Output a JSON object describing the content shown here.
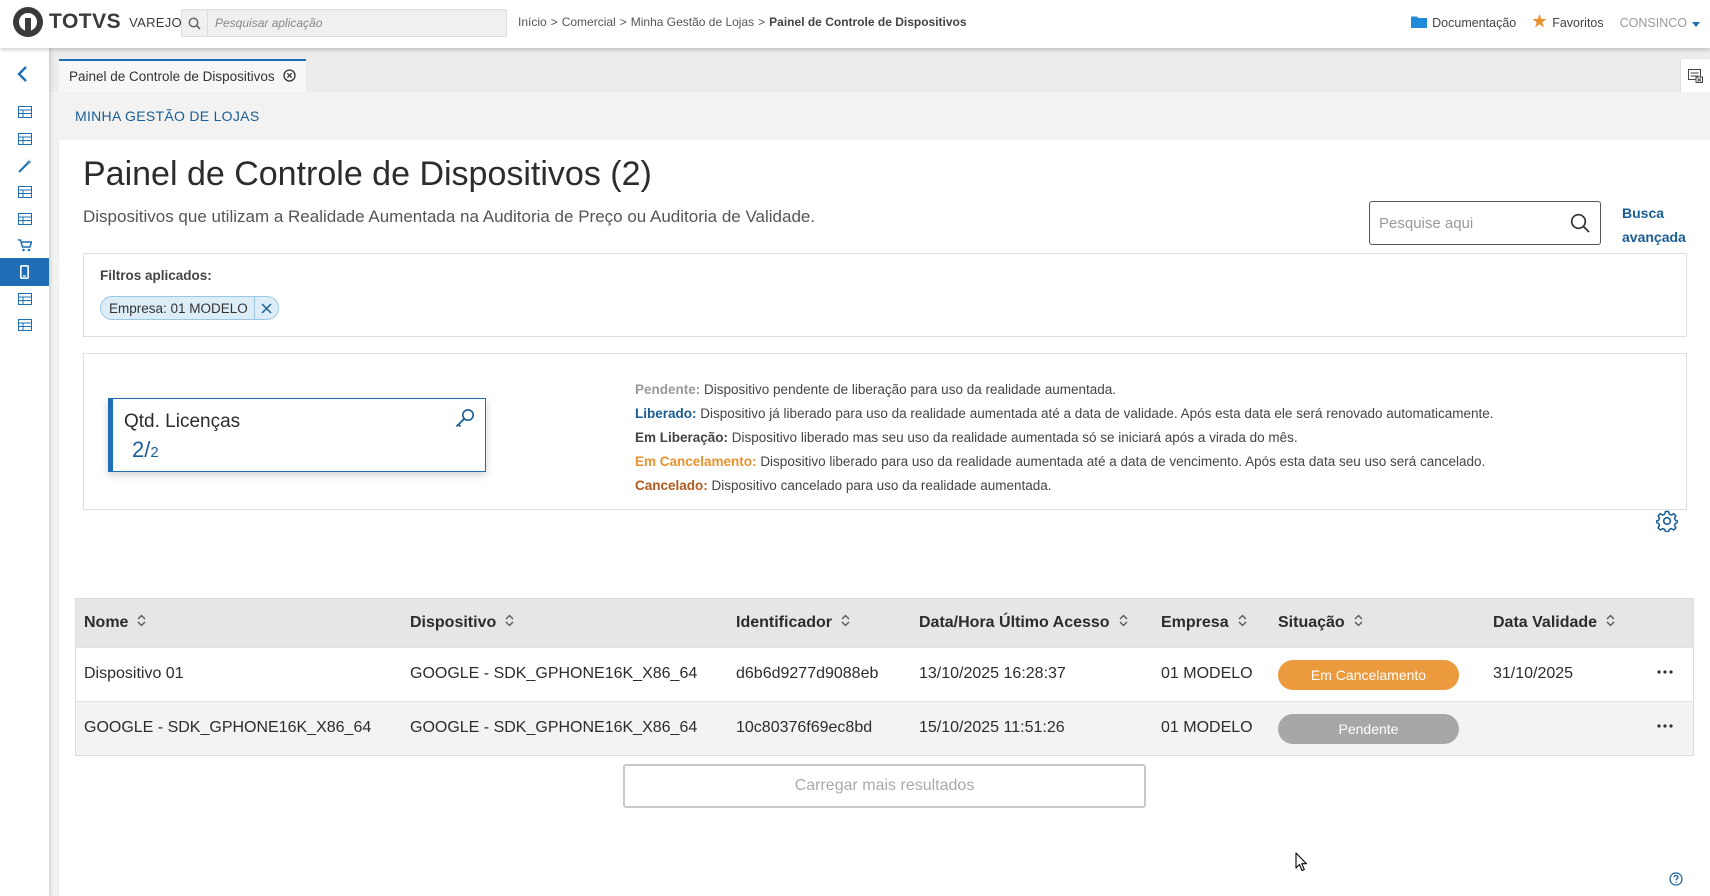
{
  "header": {
    "logo_text": "TOTVS",
    "logo_sub": "VAREJO",
    "search_placeholder": "Pesquisar aplicação",
    "breadcrumb": {
      "items": [
        "Início",
        "Comercial",
        "Minha Gestão de Lojas"
      ],
      "separator": ">",
      "current": "Painel de Controle de Dispositivos"
    },
    "documentation": "Documentação",
    "favorites": "Favoritos",
    "user": "CONSINCO"
  },
  "sidebar": {
    "items": [
      {
        "icon": "table-icon"
      },
      {
        "icon": "table-icon"
      },
      {
        "icon": "wand-icon"
      },
      {
        "icon": "table-icon"
      },
      {
        "icon": "table-icon"
      },
      {
        "icon": "cart-icon"
      },
      {
        "icon": "mobile-icon",
        "active": true
      },
      {
        "icon": "table-icon"
      },
      {
        "icon": "table-icon"
      }
    ]
  },
  "tab": {
    "label": "Painel de Controle de Dispositivos"
  },
  "section": {
    "title": "MINHA GESTÃO DE LOJAS"
  },
  "page": {
    "title": "Painel de Controle de Dispositivos (2)",
    "subtitle": "Dispositivos que utilizam a Realidade Aumentada na Auditoria de Preço ou Auditoria de Validade.",
    "search_placeholder": "Pesquise aqui",
    "advanced_search": "Busca avançada"
  },
  "filters": {
    "label": "Filtros aplicados:",
    "chips": [
      "Empresa: 01 MODELO"
    ]
  },
  "license_card": {
    "title": "Qtd. Licenças",
    "used": "2",
    "total": "2"
  },
  "legend": [
    {
      "term": "Pendente:",
      "desc": "Dispositivo pendente de liberação para uso da realidade aumentada.",
      "color": "#999999"
    },
    {
      "term": "Liberado:",
      "desc": "Dispositivo já liberado para uso da realidade aumentada até a data de validade. Após esta data ele será renovado automaticamente.",
      "color": "#1a5d94"
    },
    {
      "term": "Em Liberação:",
      "desc": "Dispositivo liberado mas seu uso da realidade aumentada só se iniciará após a virada do mês.",
      "color": "#444444"
    },
    {
      "term": "Em Cancelamento:",
      "desc": "Dispositivo liberado para uso da realidade aumentada até a data de vencimento. Após esta data seu uso será cancelado.",
      "color": "#e8922e"
    },
    {
      "term": "Cancelado:",
      "desc": "Dispositivo cancelado para uso da realidade aumentada.",
      "color": "#b35a1e"
    }
  ],
  "table": {
    "columns": [
      "Nome",
      "Dispositivo",
      "Identificador",
      "Data/Hora Último Acesso",
      "Empresa",
      "Situação",
      "Data Validade"
    ],
    "rows": [
      {
        "nome": "Dispositivo 01",
        "dispositivo": "GOOGLE - SDK_GPHONE16K_X86_64",
        "identificador": "d6b6d9277d9088eb",
        "ultimo_acesso": "13/10/2025 16:28:37",
        "empresa": "01 MODELO",
        "situacao": "Em Cancelamento",
        "situacao_color": "#ec9a3e",
        "validade": "31/10/2025"
      },
      {
        "nome": "GOOGLE - SDK_GPHONE16K_X86_64",
        "dispositivo": "GOOGLE - SDK_GPHONE16K_X86_64",
        "identificador": "10c80376f69ec8bd",
        "ultimo_acesso": "15/10/2025 11:51:26",
        "empresa": "01 MODELO",
        "situacao": "Pendente",
        "situacao_color": "#a7a7a7",
        "validade": ""
      }
    ],
    "load_more": "Carregar mais resultados"
  },
  "colors": {
    "primary": "#1f6fb6",
    "link": "#1a5d94"
  }
}
